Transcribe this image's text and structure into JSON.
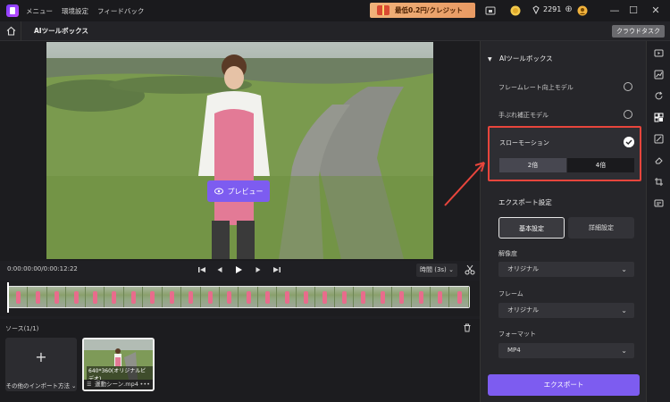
{
  "titlebar": {
    "menus": [
      "メニュー",
      "環境設定",
      "フィードバック"
    ],
    "promo_text": "最低0.2円/クレジット",
    "points": "2291"
  },
  "subbar": {
    "page_title": "AIツールボックス",
    "cloud_task": "クラウドタスク"
  },
  "preview": {
    "button_label": "プレビュー"
  },
  "controls": {
    "timecode": "0:00:00:00/0:00:12:22",
    "duration": "時間 (3s)"
  },
  "source": {
    "label": "ソース(1/1)",
    "import_label": "その他のインポート方法",
    "clip_resolution": "640*360(オリジナルビデオ)",
    "clip_name": "運動シーン.mp4"
  },
  "panel": {
    "header": "AIツールボックス",
    "options": [
      {
        "label": "フレームレート向上モデル"
      },
      {
        "label": "手ぶれ補正モデル"
      }
    ],
    "slow_motion": {
      "label": "スローモーション",
      "speeds": [
        "2倍",
        "4倍"
      ],
      "selected": "2倍"
    },
    "export_settings": {
      "header": "エクスポート設定",
      "tabs": [
        "基本設定",
        "詳細設定"
      ],
      "resolution_label": "解像度",
      "resolution_value": "オリジナル",
      "frame_label": "フレーム",
      "frame_value": "オリジナル",
      "format_label": "フォーマット",
      "format_value": "MP4"
    },
    "export_button": "エクスポート"
  },
  "colors": {
    "accent": "#7d5cf0",
    "highlight_border": "#e8453c"
  }
}
